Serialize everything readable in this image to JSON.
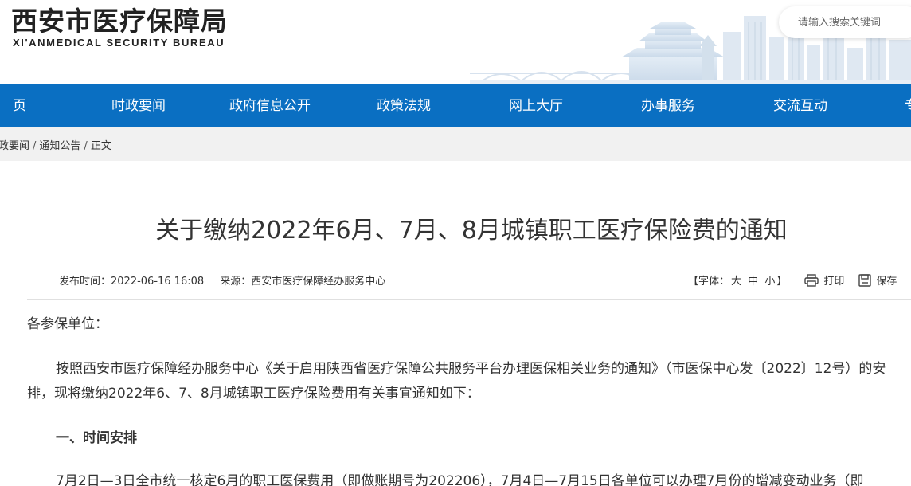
{
  "header": {
    "logo_cn": "西安市医疗保障局",
    "logo_en": "XI'ANMEDICAL SECURITY BUREAU",
    "search_placeholder": "请输入搜索关键词"
  },
  "nav": {
    "items": [
      "页",
      "时政要闻",
      "政府信息公开",
      "政策法规",
      "网上大厅",
      "办事服务",
      "交流互动",
      "专"
    ]
  },
  "breadcrumb": {
    "items": [
      "政要闻",
      "通知公告",
      "正文"
    ],
    "separator": "/"
  },
  "article": {
    "title": "关于缴纳2022年6月、7月、8月城镇职工医疗保险费的通知",
    "publish_time": "发布时间：2022-06-16 16:08",
    "source": "来源：西安市医疗保障经办服务中心",
    "font_size_label": "【字体：",
    "font_large": "大",
    "font_medium": "中",
    "font_small": "小",
    "font_close": "】",
    "print_label": "打印",
    "save_label": "保存",
    "salutation": "各参保单位：",
    "paragraph1": "按照西安市医疗保障经办服务中心《关于启用陕西省医疗保障公共服务平台办理医保相关业务的通知》（市医保中心发〔2022〕12号）的安排，现将缴纳2022年6、7、8月城镇职工医疗保险费用有关事宜通知如下：",
    "section1_heading": "一、时间安排",
    "paragraph2": "7月2日—3日全市统一核定6月的职工医保费用（即做账期号为202206），7月4日—7月15日各单位可以办理7月份的增减变动业务（即"
  },
  "colors": {
    "nav_bg": "#0a6fc2",
    "breadcrumb_bg": "#f1f1f1"
  }
}
